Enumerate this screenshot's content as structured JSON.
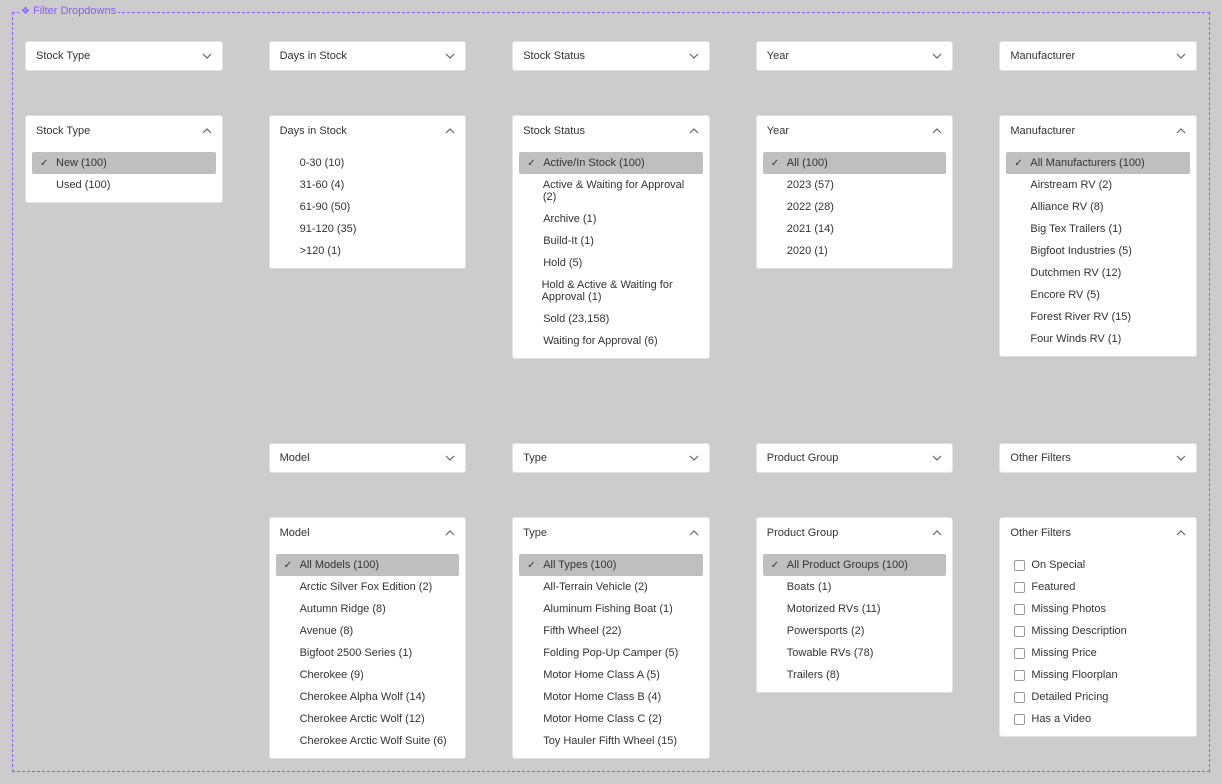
{
  "panel": {
    "title": "Filter Dropdowns"
  },
  "stockType": {
    "label": "Stock Type",
    "options": [
      {
        "label": "New (100)",
        "selected": true
      },
      {
        "label": "Used (100)",
        "selected": false
      }
    ]
  },
  "daysInStock": {
    "label": "Days in Stock",
    "options": [
      {
        "label": "0-30 (10)"
      },
      {
        "label": "31-60 (4)"
      },
      {
        "label": "61-90 (50)"
      },
      {
        "label": "91-120 (35)"
      },
      {
        "label": ">120 (1)"
      }
    ]
  },
  "stockStatus": {
    "label": "Stock Status",
    "options": [
      {
        "label": "Active/In Stock (100)",
        "selected": true
      },
      {
        "label": "Active & Waiting for Approval (2)"
      },
      {
        "label": "Archive (1)"
      },
      {
        "label": "Build-It (1)"
      },
      {
        "label": "Hold (5)"
      },
      {
        "label": "Hold & Active & Waiting for Approval (1)"
      },
      {
        "label": "Sold (23,158)"
      },
      {
        "label": "Waiting for Approval (6)"
      }
    ]
  },
  "year": {
    "label": "Year",
    "options": [
      {
        "label": "All (100)",
        "selected": true
      },
      {
        "label": "2023 (57)"
      },
      {
        "label": "2022 (28)"
      },
      {
        "label": "2021 (14)"
      },
      {
        "label": "2020 (1)"
      }
    ]
  },
  "manufacturer": {
    "label": "Manufacturer",
    "options": [
      {
        "label": "All Manufacturers (100)",
        "selected": true
      },
      {
        "label": "Airstream RV (2)"
      },
      {
        "label": "Alliance RV (8)"
      },
      {
        "label": "Big Tex Trailers (1)"
      },
      {
        "label": "Bigfoot Industries (5)"
      },
      {
        "label": "Dutchmen RV (12)"
      },
      {
        "label": "Encore RV (5)"
      },
      {
        "label": "Forest River RV (15)"
      },
      {
        "label": "Four Winds RV (1)"
      }
    ]
  },
  "model": {
    "label": "Model",
    "options": [
      {
        "label": "All Models (100)",
        "selected": true
      },
      {
        "label": "Arctic Silver Fox Edition (2)"
      },
      {
        "label": "Autumn Ridge (8)"
      },
      {
        "label": "Avenue (8)"
      },
      {
        "label": "Bigfoot 2500 Series (1)"
      },
      {
        "label": "Cherokee (9)"
      },
      {
        "label": "Cherokee Alpha Wolf (14)"
      },
      {
        "label": "Cherokee Arctic Wolf (12)"
      },
      {
        "label": "Cherokee Arctic Wolf Suite (6)"
      }
    ]
  },
  "type": {
    "label": "Type",
    "options": [
      {
        "label": "All Types (100)",
        "selected": true
      },
      {
        "label": "All-Terrain Vehicle (2)"
      },
      {
        "label": "Aluminum Fishing Boat (1)"
      },
      {
        "label": "Fifth Wheel (22)"
      },
      {
        "label": "Folding Pop-Up Camper (5)"
      },
      {
        "label": "Motor Home Class A (5)"
      },
      {
        "label": "Motor Home Class B (4)"
      },
      {
        "label": "Motor Home Class C (2)"
      },
      {
        "label": "Toy Hauler Fifth Wheel (15)"
      }
    ]
  },
  "productGroup": {
    "label": "Product Group",
    "options": [
      {
        "label": "All Product Groups (100)",
        "selected": true
      },
      {
        "label": "Boats (1)"
      },
      {
        "label": "Motorized RVs (11)"
      },
      {
        "label": "Powersports (2)"
      },
      {
        "label": "Towable RVs (78)"
      },
      {
        "label": "Trailers (8)"
      }
    ]
  },
  "otherFilters": {
    "label": "Other Filters",
    "options": [
      {
        "label": "On Special"
      },
      {
        "label": "Featured"
      },
      {
        "label": "Missing Photos"
      },
      {
        "label": "Missing Description"
      },
      {
        "label": "Missing Price"
      },
      {
        "label": "Missing Floorplan"
      },
      {
        "label": "Detailed Pricing"
      },
      {
        "label": "Has a Video"
      }
    ]
  }
}
